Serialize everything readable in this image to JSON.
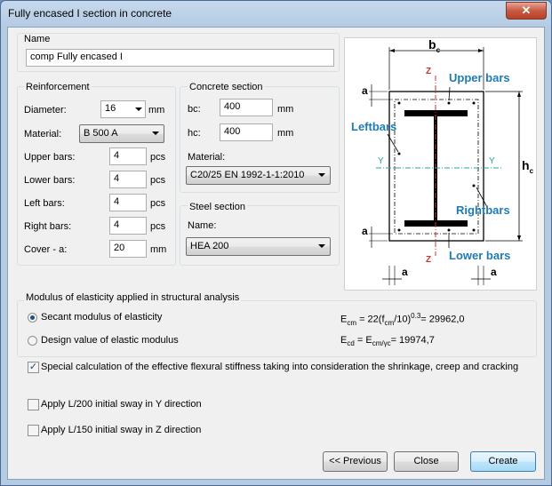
{
  "window": {
    "title": "Fully encased I section in concrete",
    "close_glyph": "✕"
  },
  "name_group": {
    "legend": "Name",
    "value": "comp Fully encased I"
  },
  "reinforcement": {
    "legend": "Reinforcement",
    "diameter_label": "Diameter:",
    "diameter_value": "16",
    "diameter_unit": "mm",
    "material_label": "Material:",
    "material_value": "B 500 A",
    "upper_label": "Upper bars:",
    "upper_value": "4",
    "upper_unit": "pcs",
    "lower_label": "Lower bars:",
    "lower_value": "4",
    "lower_unit": "pcs",
    "left_label": "Left bars:",
    "left_value": "4",
    "left_unit": "pcs",
    "right_label": "Right bars:",
    "right_value": "4",
    "right_unit": "pcs",
    "cover_label": "Cover - a:",
    "cover_value": "20",
    "cover_unit": "mm"
  },
  "concrete": {
    "legend": "Concrete section",
    "bc_label": "bc:",
    "bc_value": "400",
    "bc_unit": "mm",
    "hc_label": "hc:",
    "hc_value": "400",
    "hc_unit": "mm",
    "material_label": "Material:",
    "material_value": "C20/25  EN 1992-1-1:2010"
  },
  "steel": {
    "legend": "Steel section",
    "name_label": "Name:",
    "name_value": "HEA 200"
  },
  "diagram": {
    "bc": "b",
    "bc_sub": "c",
    "hc": "h",
    "hc_sub": "c",
    "upper_bars": "Upper bars",
    "lower_bars": "Lower bars",
    "left_bars": "Leftbars",
    "right_bars": "Rightbars",
    "a": "a",
    "y": "Y",
    "z": "Z",
    "colors": {
      "label": "#1f7bb5",
      "axis_z": "#d32f2f",
      "axis_y": "#2aa198"
    }
  },
  "modulus": {
    "legend": "Modulus of elasticity applied in structural analysis",
    "secant_label": "Secant modulus of elasticity",
    "design_label": "Design value of elastic modulus",
    "secant_selected": true,
    "ecm_eq": "= 22(f",
    "ecm_mid": "/10)",
    "ecm_exp": "0.3",
    "ecm_result": "= 29962,0",
    "ecd_eq": "= E",
    "ecd_sub": "cm/γc",
    "ecd_result": "= 19974,7",
    "e": "E",
    "cm": "cm",
    "cd": "cd"
  },
  "options": {
    "special_label": "Special calculation of the effective flexural stiffness taking into consideration the shrinkage, creep and cracking",
    "special_checked": true,
    "sway_y_label": "Apply L/200 initial sway in Y direction",
    "sway_y_checked": false,
    "sway_z_label": "Apply L/150 initial sway in Z direction",
    "sway_z_checked": false,
    "check_glyph": "✓"
  },
  "buttons": {
    "previous": "<< Previous",
    "close": "Close",
    "create": "Create"
  }
}
